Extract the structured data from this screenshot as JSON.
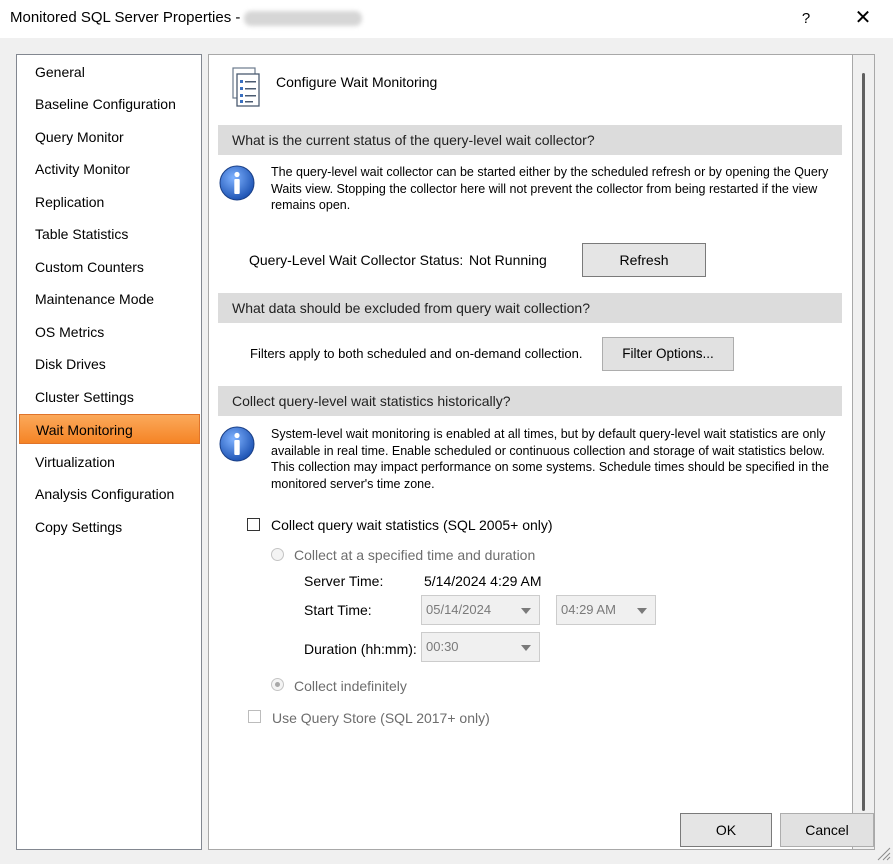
{
  "window": {
    "title": "Monitored SQL Server Properties -",
    "help_label": "?",
    "close_label": "✕"
  },
  "nav": {
    "items": [
      "General",
      "Baseline Configuration",
      "Query Monitor",
      "Activity Monitor",
      "Replication",
      "Table Statistics",
      "Custom Counters",
      "Maintenance Mode",
      "OS Metrics",
      "Disk Drives",
      "Cluster Settings",
      "Wait Monitoring",
      "Virtualization",
      "Analysis Configuration",
      "Copy Settings"
    ],
    "selected": "Wait Monitoring"
  },
  "page": {
    "title": "Configure Wait Monitoring",
    "icon": "document-list-icon"
  },
  "status_section": {
    "header": "What is the current status of the query-level wait collector?",
    "info": "The query-level wait collector can be started either by the scheduled refresh or by opening the Query Waits view.  Stopping the collector here will not prevent the collector from being restarted if the view remains open.",
    "status_label": "Query-Level Wait Collector Status:",
    "status_value": "Not Running",
    "refresh_button": "Refresh"
  },
  "exclude_section": {
    "header": "What data should be excluded from query wait collection?",
    "text": "Filters apply to both scheduled and on-demand collection.",
    "filter_button": "Filter Options..."
  },
  "history_section": {
    "header": "Collect query-level wait statistics historically?",
    "info": "System-level wait monitoring is enabled at all times, but by default query-level wait statistics are only available in real time.  Enable scheduled or continuous collection and storage of wait statistics below.  This collection may impact performance on some systems.  Schedule times should be specified in the monitored server's time zone.",
    "collect_checkbox": "Collect query wait statistics (SQL 2005+ only)",
    "collect_checked": false,
    "radio_specified": "Collect at a specified time and duration",
    "server_time_label": "Server Time:",
    "server_time_value": "5/14/2024 4:29 AM",
    "start_time_label": "Start Time:",
    "start_date_value": "05/14/2024",
    "start_time_value": "04:29 AM",
    "duration_label": "Duration (hh:mm):",
    "duration_value": "00:30",
    "radio_indefinite": "Collect indefinitely",
    "radio_indefinite_checked": true,
    "query_store_checkbox": "Use Query Store (SQL 2017+ only)",
    "query_store_checked": false
  },
  "footer": {
    "ok_button": "OK",
    "cancel_button": "Cancel"
  },
  "colors": {
    "selected_nav": "#f58425",
    "band": "#dcdcdc",
    "info_icon": "#1f55b5"
  }
}
